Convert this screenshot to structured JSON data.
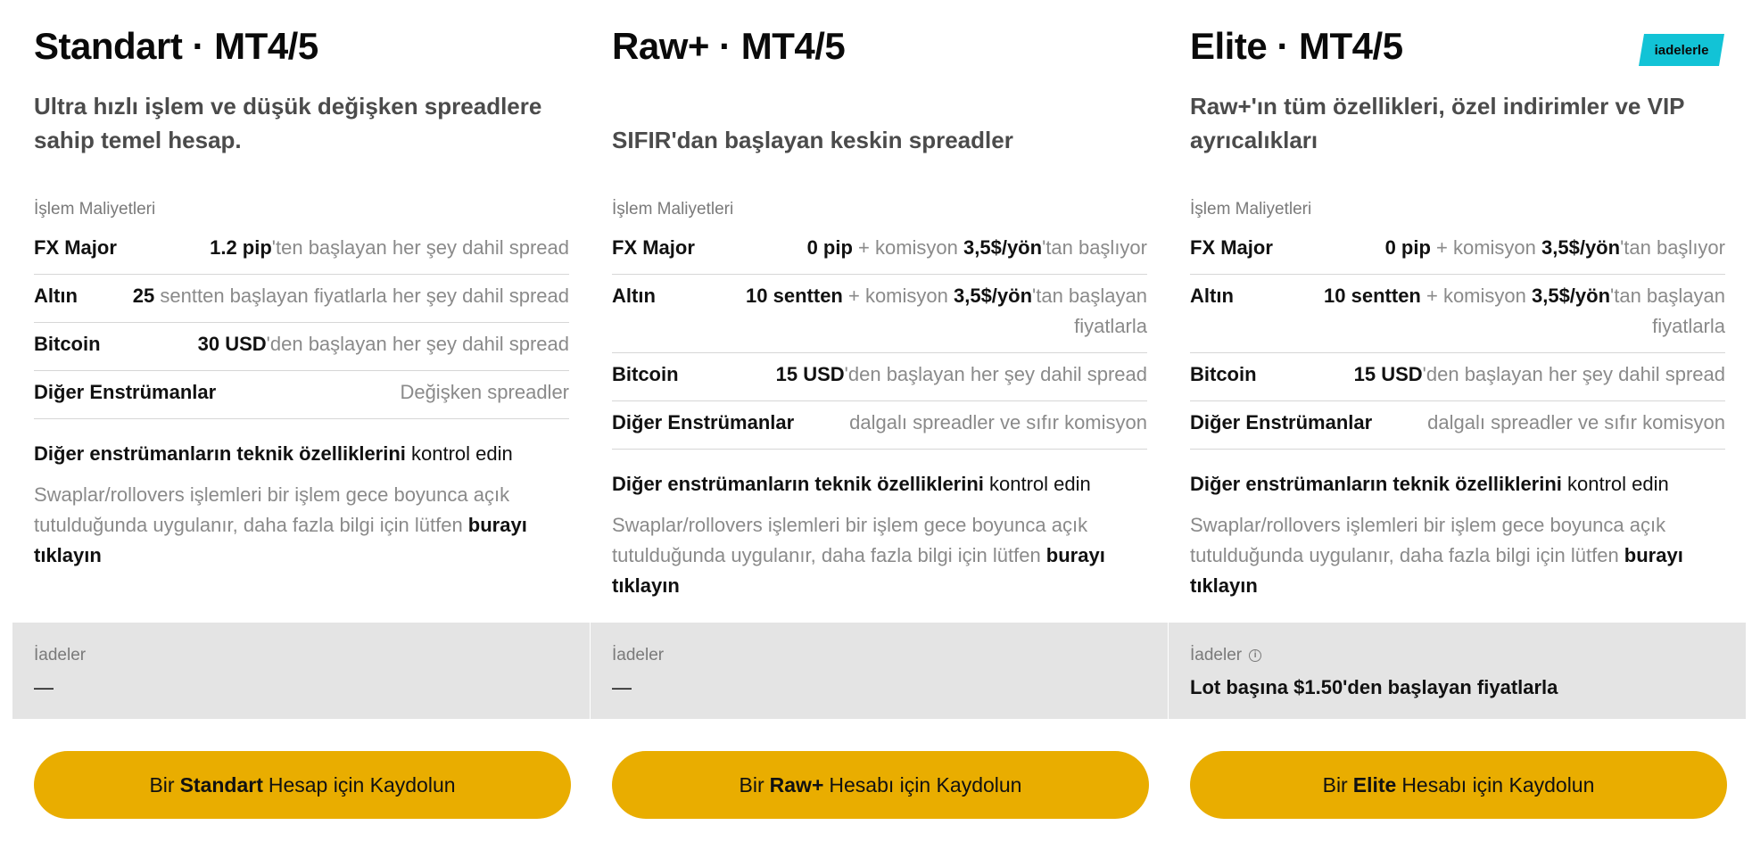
{
  "plans": [
    {
      "title": "Standart · MT4/5",
      "subtitle": "Ultra hızlı işlem ve düşük değişken spreadlere sahip temel hesap.",
      "costs_label": "İşlem Maliyetleri",
      "costs": [
        {
          "label": "FX Major",
          "bold": "1.2 pip",
          "rest": "'ten başlayan her şey dahil spread"
        },
        {
          "label": "Altın",
          "bold": "25",
          "rest": " sentten başlayan fiyatlarla her şey dahil spread"
        },
        {
          "label": "Bitcoin",
          "bold": "30 USD",
          "rest": "'den başlayan her şey dahil spread"
        },
        {
          "label": "Diğer Enstrümanlar",
          "bold": "",
          "rest": "Değişken spreadler"
        }
      ],
      "tech_bold": "Diğer enstrümanların teknik özelliklerini",
      "tech_rest": " kontrol edin",
      "swap_text": "Swaplar/rollovers işlemleri bir işlem gece boyunca açık tutulduğunda uygulanır, daha fazla bilgi için lütfen ",
      "swap_link": "burayı tıklayın",
      "rebates_label": "İadeler",
      "rebates_value": "—",
      "cta_pre": "Bir",
      "cta_bold": "Standart",
      "cta_post": "Hesap için Kaydolun"
    },
    {
      "title": "Raw+ · MT4/5",
      "subtitle": "SIFIR'dan başlayan keskin spreadler",
      "costs_label": "İşlem Maliyetleri",
      "costs": [
        {
          "label": "FX Major",
          "bold": "0 pip",
          "mid": " + komisyon ",
          "bold2": "3,5$/yön",
          "rest": "'tan başlıyor"
        },
        {
          "label": "Altın",
          "bold": "10 sentten",
          "mid": " + komisyon ",
          "bold2": "3,5$/yön",
          "rest": "'tan başlayan fiyatlarla"
        },
        {
          "label": "Bitcoin",
          "bold": "15 USD",
          "rest": "'den başlayan her şey dahil spread"
        },
        {
          "label": "Diğer Enstrümanlar",
          "bold": "",
          "rest": "dalgalı spreadler ve sıfır komisyon"
        }
      ],
      "tech_bold": "Diğer enstrümanların teknik özelliklerini",
      "tech_rest": " kontrol edin",
      "swap_text": "Swaplar/rollovers işlemleri bir işlem gece boyunca açık tutulduğunda uygulanır, daha fazla bilgi için lütfen ",
      "swap_link": "burayı tıklayın",
      "rebates_label": "İadeler",
      "rebates_value": "—",
      "cta_pre": "Bir",
      "cta_bold": "Raw+",
      "cta_post": "Hesabı için Kaydolun"
    },
    {
      "title": "Elite · MT4/5",
      "badge": "iadelerle",
      "subtitle": "Raw+'ın tüm özellikleri, özel indirimler ve VIP ayrıcalıkları",
      "costs_label": "İşlem Maliyetleri",
      "costs": [
        {
          "label": "FX Major",
          "bold": "0 pip",
          "mid": " + komisyon ",
          "bold2": "3,5$/yön",
          "rest": "'tan başlıyor"
        },
        {
          "label": "Altın",
          "bold": "10 sentten",
          "mid": " + komisyon ",
          "bold2": "3,5$/yön",
          "rest": "'tan başlayan fiyatlarla"
        },
        {
          "label": "Bitcoin",
          "bold": "15 USD",
          "rest": "'den başlayan her şey dahil spread"
        },
        {
          "label": "Diğer Enstrümanlar",
          "bold": "",
          "rest": "dalgalı spreadler ve sıfır komisyon"
        }
      ],
      "tech_bold": "Diğer enstrümanların teknik özelliklerini",
      "tech_rest": " kontrol edin",
      "swap_text": "Swaplar/rollovers işlemleri bir işlem gece boyunca açık tutulduğunda uygulanır, daha fazla bilgi için lütfen ",
      "swap_link": "burayı tıklayın",
      "rebates_label": "İadeler",
      "rebates_value": "Lot başına $1.50'den başlayan fiyatlarla",
      "cta_pre": "Bir",
      "cta_bold": "Elite",
      "cta_post": "Hesabı için Kaydolun"
    }
  ],
  "colors": {
    "cta": "#e9ad00",
    "badge": "#12c3d6",
    "rebate_bg": "#e4e4e4"
  }
}
